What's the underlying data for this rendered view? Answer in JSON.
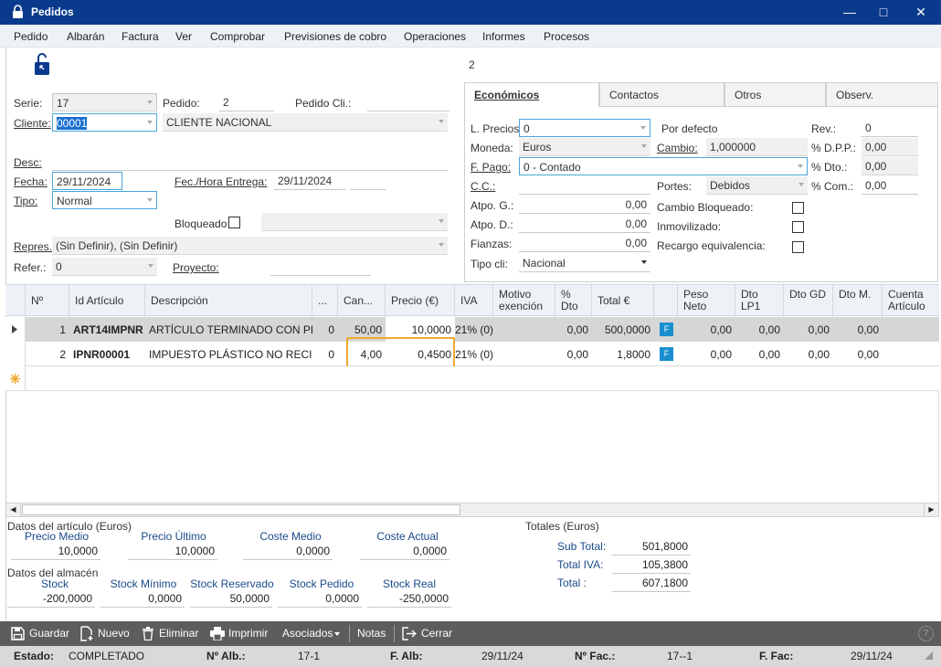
{
  "window": {
    "title": "Pedidos"
  },
  "menu": [
    "Pedido",
    "Albarán",
    "Factura",
    "Ver",
    "Comprobar",
    "Previsiones de cobro",
    "Operaciones",
    "Informes",
    "Procesos"
  ],
  "header_number": "2",
  "form": {
    "serie_label": "Serie:",
    "serie_value": "17",
    "pedido_label": "Pedido:",
    "pedido_value": "2",
    "pedido_cli_label": "Pedido Cli.:",
    "cliente_label": "Cliente:",
    "cliente_code": "00001",
    "cliente_name": "CLIENTE NACIONAL",
    "desc_label": "Desc:",
    "fecha_label": "Fecha:",
    "fecha_value": "29/11/2024",
    "fec_entrega_label": "Fec./Hora Entrega:",
    "fec_entrega_value": "29/11/2024",
    "tipo_label": "Tipo:",
    "tipo_value": "Normal",
    "bloqueado_label": "Bloqueado",
    "repres_label": "Repres.:",
    "repres_value": "(Sin Definir), (Sin Definir)",
    "refer_label": "Refer.:",
    "refer_value": "0",
    "proyecto_label": "Proyecto:"
  },
  "tabs": [
    "Económicos",
    "Contactos",
    "Otros",
    "Observ."
  ],
  "economicos": {
    "l_precios_label": "L. Precios",
    "l_precios_value": "0",
    "por_defecto": "Por defecto",
    "rev_label": "Rev.:",
    "rev_value": "0",
    "moneda_label": "Moneda:",
    "moneda_value": "Euros",
    "cambio_label": "Cambio:",
    "cambio_value": "1,000000",
    "dpp_label": "% D.P.P.:",
    "dpp_value": "0,00",
    "fpago_label": "F. Pago:",
    "fpago_value": "0 - Contado",
    "dto_label": "% Dto.:",
    "dto_value": "0,00",
    "cc_label": "C.C.:",
    "portes_label": "Portes:",
    "portes_value": "Debidos",
    "com_label": "% Com.:",
    "com_value": "0,00",
    "atpo_g_label": "Atpo. G.:",
    "atpo_g_value": "0,00",
    "atpo_d_label": "Atpo. D.:",
    "atpo_d_value": "0,00",
    "fianzas_label": "Fianzas:",
    "fianzas_value": "0,00",
    "tipo_cli_label": "Tipo cli:",
    "tipo_cli_value": "Nacional",
    "cambio_bloq_label": "Cambio Bloqueado:",
    "inmovilizado_label": "Inmovilizado:",
    "recargo_label": "Recargo equivalencia:"
  },
  "grid": {
    "headers": {
      "n": "Nº",
      "id": "Id Artículo",
      "desc": "Descripción",
      "dots": "...",
      "can": "Can...",
      "precio": "Precio (€)",
      "iva": "IVA",
      "motivo": "Motivo exención",
      "pdto": "% Dto",
      "total": "Total €",
      "peso": "Peso Neto",
      "dtolp1": "Dto LP1",
      "dtogd": "Dto GD",
      "dtom": "Dto M.",
      "cuenta": "Cuenta Artículo"
    },
    "rows": [
      {
        "n": "1",
        "id": "ART14IMPNR",
        "desc": "ARTÍCULO TERMINADO CON PL...",
        "dots": "0",
        "can": "50,00",
        "precio": "10,0000",
        "iva": "21% (0)",
        "pdto": "0,00",
        "total": "500,0000",
        "badge": "F",
        "peso": "0,00",
        "dtolp1": "0,00",
        "dtogd": "0,00",
        "dtom": "0,00"
      },
      {
        "n": "2",
        "id": "IPNR00001",
        "desc": "IMPUESTO PLÁSTICO NO RECI...",
        "dots": "0",
        "can": "4,00",
        "precio": "0,4500",
        "iva": "21% (0)",
        "pdto": "0,00",
        "total": "1,8000",
        "badge": "F",
        "peso": "0,00",
        "dtolp1": "0,00",
        "dtogd": "0,00",
        "dtom": "0,00"
      }
    ]
  },
  "articulo": {
    "title": "Datos del artículo (Euros)",
    "items": [
      {
        "label": "Precio Medio",
        "value": "10,0000"
      },
      {
        "label": "Precio Último",
        "value": "10,0000"
      },
      {
        "label": "Coste Medio",
        "value": "0,0000"
      },
      {
        "label": "Coste Actual",
        "value": "0,0000"
      }
    ]
  },
  "almacen": {
    "title": "Datos del almacén",
    "items": [
      {
        "label": "Stock",
        "value": "-200,0000"
      },
      {
        "label": "Stock Mínimo",
        "value": "0,0000"
      },
      {
        "label": "Stock Reservado",
        "value": "50,0000"
      },
      {
        "label": "Stock Pedido",
        "value": "0,0000"
      },
      {
        "label": "Stock Real",
        "value": "-250,0000"
      }
    ]
  },
  "totales": {
    "title": "Totales (Euros)",
    "sub_total_label": "Sub Total:",
    "sub_total": "501,8000",
    "total_iva_label": "Total IVA:",
    "total_iva": "105,3800",
    "total_label": "Total :",
    "total": "607,1800"
  },
  "toolbar": {
    "guardar": "Guardar",
    "nuevo": "Nuevo",
    "eliminar": "Eliminar",
    "imprimir": "Imprimir",
    "asociados": "Asociados",
    "notas": "Notas",
    "cerrar": "Cerrar"
  },
  "status": {
    "estado_label": "Estado:",
    "estado_value": "COMPLETADO",
    "n_alb_label": "Nº Alb.:",
    "n_alb_value": "17-1",
    "f_alb_label": "F. Alb:",
    "f_alb_value": "29/11/24",
    "n_fac_label": "Nº Fac.:",
    "n_fac_value": "17--1",
    "f_fac_label": "F. Fac:",
    "f_fac_value": "29/11/24"
  },
  "colors": {
    "title_bar": "#0a3a8c",
    "accent": "#4aa5d8",
    "highlight": "#f0a830",
    "badge": "#1a8fd0"
  }
}
